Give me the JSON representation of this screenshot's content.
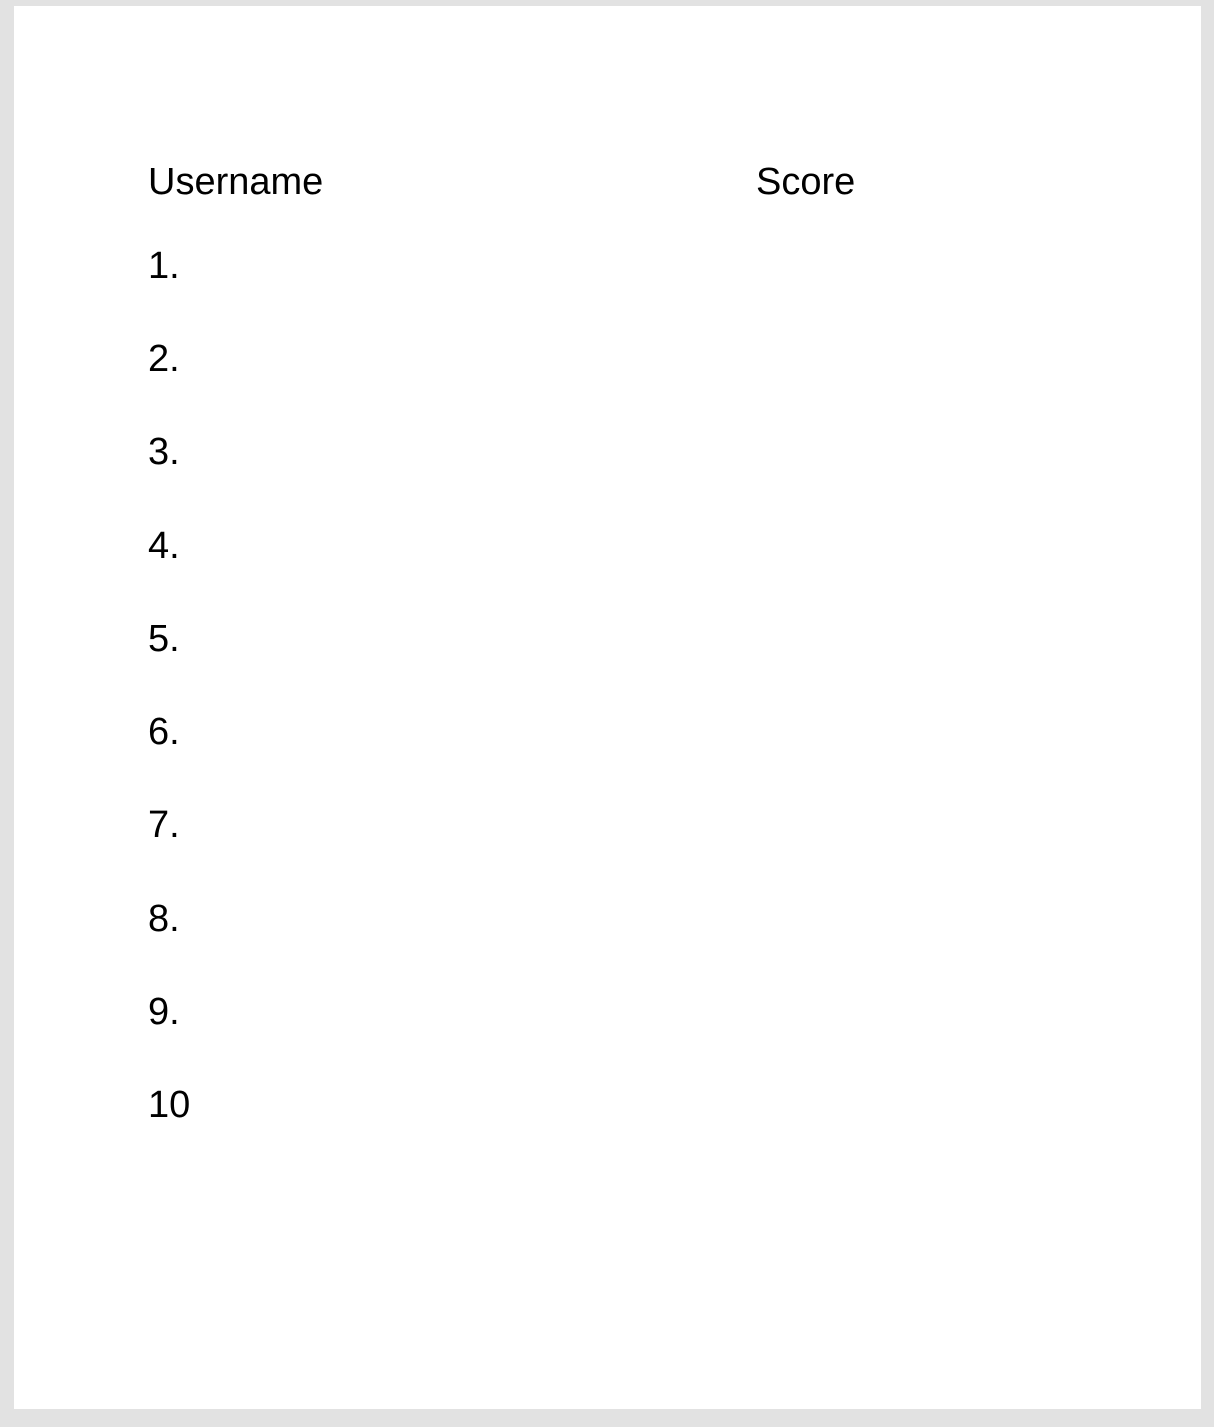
{
  "leaderboard": {
    "headers": {
      "username": "Username",
      "score": "Score"
    },
    "rows": [
      {
        "rank": "1.",
        "username": "",
        "score": ""
      },
      {
        "rank": "2.",
        "username": "",
        "score": ""
      },
      {
        "rank": "3.",
        "username": "",
        "score": ""
      },
      {
        "rank": "4.",
        "username": "",
        "score": ""
      },
      {
        "rank": "5.",
        "username": "",
        "score": ""
      },
      {
        "rank": "6.",
        "username": "",
        "score": ""
      },
      {
        "rank": "7.",
        "username": "",
        "score": ""
      },
      {
        "rank": "8.",
        "username": "",
        "score": ""
      },
      {
        "rank": "9.",
        "username": "",
        "score": ""
      },
      {
        "rank": "10",
        "username": "",
        "score": ""
      }
    ]
  },
  "colors": {
    "background": "#e2e2e2",
    "panel": "#ffffff",
    "text": "#000000"
  }
}
